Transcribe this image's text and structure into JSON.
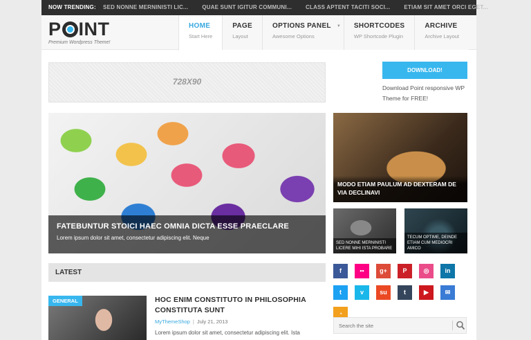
{
  "trending": {
    "label": "NOW TRENDING:",
    "items": [
      "SED NONNE MERNINISTI LIC...",
      "QUAE SUNT IGITUR COMMUNI...",
      "CLASS APTENT TACITI SOCI...",
      "ETIAM SIT AMET ORCI EGET..."
    ]
  },
  "logo": {
    "text_pre": "P",
    "text_post": "INT",
    "tagline": "Premium Wordpress Theme!"
  },
  "nav": [
    {
      "title": "HOME",
      "sub": "Start Here"
    },
    {
      "title": "PAGE",
      "sub": "Layout"
    },
    {
      "title": "OPTIONS PANEL",
      "sub": "Awesome Options"
    },
    {
      "title": "SHORTCODES",
      "sub": "WP Shortcode Plugin"
    },
    {
      "title": "ARCHIVE",
      "sub": "Archive Layout"
    }
  ],
  "ad": {
    "label": "728X90"
  },
  "download": {
    "button": "DOWNLOAD!",
    "text": "Download Point responsive WP Theme for FREE!"
  },
  "featured": {
    "big": {
      "title": "FATEBUNTUR STOICI HAEC OMNIA DICTA ESSE PRAECLARE",
      "excerpt": "Lorem ipsum dolor sit amet, consectetur adipiscing elit. Neque"
    },
    "right": {
      "title": "MODO ETIAM PAULUM AD DEXTERAM DE VIA DECLINAVI"
    },
    "small_a": {
      "title": "SED NONNE MERNINISTI LICERE MIHI ISTA PROBARE"
    },
    "small_b": {
      "title": "TECUM OPTIME, DEINDE ETIAM CUM MEDIOCRI AMICO"
    }
  },
  "latest": {
    "heading": "LATEST"
  },
  "post": {
    "category": "GENERAL",
    "title": "HOC ENIM CONSTITUTO IN PHILOSOPHIA CONSTITUTA SUNT",
    "author": "MyThemeShop",
    "date": "July 21, 2013",
    "excerpt": "Lorem ipsum dolor sit amet, consectetur adipiscing elit. Ista"
  },
  "social": [
    {
      "icon": "facebook-icon",
      "glyph": "f",
      "color": "#3b5998"
    },
    {
      "icon": "flickr-icon",
      "glyph": "••",
      "color": "#ff0084"
    },
    {
      "icon": "google-plus-icon",
      "glyph": "g+",
      "color": "#dd4b39"
    },
    {
      "icon": "pinterest-icon",
      "glyph": "P",
      "color": "#cb2027"
    },
    {
      "icon": "dribbble-icon",
      "glyph": "◎",
      "color": "#ea4c89"
    },
    {
      "icon": "linkedin-icon",
      "glyph": "in",
      "color": "#0e76a8"
    },
    {
      "icon": "twitter-icon",
      "glyph": "t",
      "color": "#1da1f2"
    },
    {
      "icon": "vimeo-icon",
      "glyph": "v",
      "color": "#1ab7ea"
    },
    {
      "icon": "stumbleupon-icon",
      "glyph": "su",
      "color": "#eb4924"
    },
    {
      "icon": "tumblr-icon",
      "glyph": "t",
      "color": "#35465c"
    },
    {
      "icon": "youtube-icon",
      "glyph": "▶",
      "color": "#cc181e"
    },
    {
      "icon": "email-icon",
      "glyph": "✉",
      "color": "#3a7bd5"
    },
    {
      "icon": "rss-icon",
      "glyph": "◔",
      "color": "#f2a01e"
    }
  ],
  "search": {
    "placeholder": "Search the site"
  },
  "colors": {
    "accent": "#38b7ee",
    "dark_bar": "#2e2e2e"
  }
}
